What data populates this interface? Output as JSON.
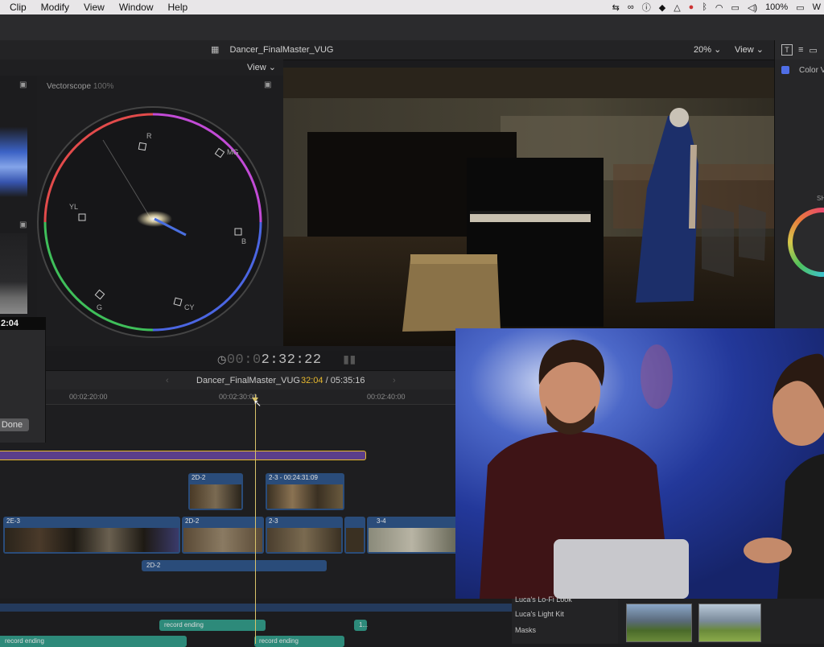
{
  "menubar": {
    "items": [
      "Clip",
      "Modify",
      "View",
      "Window",
      "Help"
    ],
    "battery": "100%",
    "extra": "W"
  },
  "titlebar": {
    "document_title": "Dancer_FinalMaster_VUG",
    "zoom": "20% ⌄",
    "view_menu": "View ⌄"
  },
  "scopes": {
    "view_menu": "View ⌄",
    "vectorscope_label": "Vectorscope",
    "vectorscope_pct": "100%",
    "targets": [
      "R",
      "MG",
      "B",
      "CY",
      "G",
      "YL"
    ]
  },
  "inspector": {
    "color_label": "Color V",
    "sh_label": "SH"
  },
  "playback": {
    "timecode_dim": "00:0",
    "timecode_main": "2:32:22"
  },
  "timeline": {
    "project_name": "Dancer_FinalMaster_VUG",
    "position": "32:04",
    "duration": "/ 05:35:16",
    "ruler": [
      "00:02:20:00",
      "00:02:30:00",
      "00:02:40:00"
    ],
    "popup_tc": "2:04",
    "done_label": "Done",
    "clips": {
      "upper_a": "2D-2",
      "upper_b": "2-3 - 00:24:31:09",
      "main_1": "2E-3",
      "main_2": "2D-2",
      "main_3": "2-3",
      "main_4": "3-4",
      "audio_1": "2D-2",
      "rec_1": "record ending",
      "rec_2": "1...",
      "rec_3": "record ending",
      "rec_4": "record ending"
    }
  },
  "browser": {
    "items": [
      "Luca's Lo-Fi Look",
      "Luca's Light Kit",
      "Masks"
    ]
  },
  "colors": {
    "accent_yellow": "#e8b92e",
    "storyline_purple": "#5b3e8a",
    "clip_blue": "#2a4c7a",
    "audio_teal": "#2d8a7a"
  }
}
